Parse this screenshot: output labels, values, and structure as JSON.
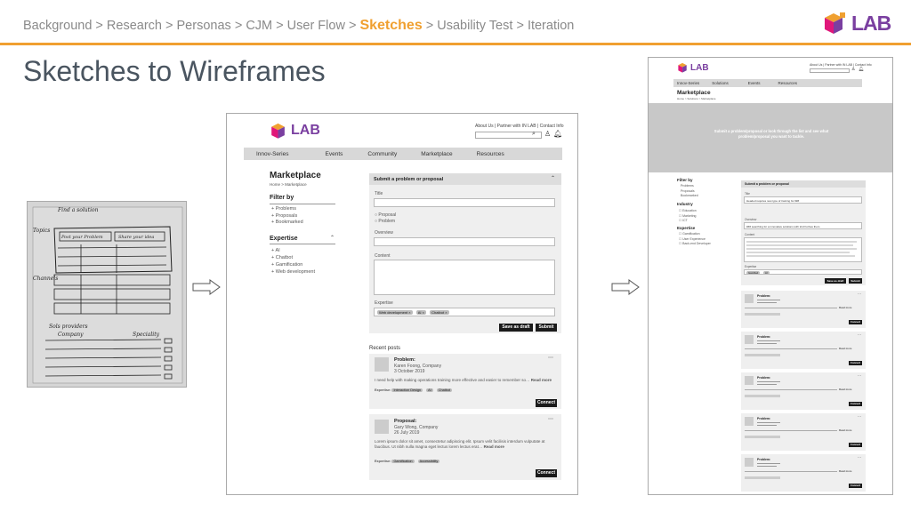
{
  "breadcrumb": [
    "Background",
    "Research",
    "Personas",
    "CJM",
    "User Flow",
    "Sketches",
    "Usability Test",
    "Iteration"
  ],
  "breadcrumb_active": "Sketches",
  "breadcrumb_sep": ">",
  "brand": "LAB",
  "title": "Sketches to Wireframes",
  "colors": {
    "accent": "#f0a030",
    "text_grey": "#8a8a8a",
    "title": "#4a5560",
    "logo_purple": "#7a3fa0",
    "logo_pink": "#e0177a",
    "logo_orange": "#f0a030"
  },
  "sketch": {
    "notes": [
      "Find a solution",
      "Topics",
      "Post your Problem",
      "Share your idea",
      "Channels",
      "Sols providers",
      "Company",
      "Speciality"
    ]
  },
  "wf1": {
    "top_links": "About Us | Partner with IN LAB | Contact Info",
    "nav": [
      "Innov-Series",
      "Events",
      "Community",
      "Marketplace",
      "Resources"
    ],
    "page_title": "Marketplace",
    "breadcrumb": "Home > Marketplace",
    "filter_title": "Filter by",
    "filters": [
      "Problems",
      "Proposals",
      "Bookmarked"
    ],
    "expertise_title": "Expertise",
    "expertise": [
      "AI",
      "Chatbot",
      "Gamification",
      "Web development"
    ],
    "form": {
      "header": "Submit a problem or proposal",
      "title_label": "Title",
      "radio_proposal": "Proposal",
      "radio_problem": "Problem",
      "overview_label": "Overview",
      "content_label": "Content",
      "expertise_label": "Expertise",
      "tags": [
        "Web development",
        "AI",
        "Chatbot"
      ],
      "draft_btn": "Save as draft",
      "submit_btn": "Submit"
    },
    "recent_title": "Recent posts",
    "posts": [
      {
        "type": "Problem:",
        "author": "Karen Foong, Company",
        "date": "3 October 2019",
        "text": "I need help with making operations training more effective and easier to remember so…",
        "more": "Read more",
        "exp_label": "Expertise:",
        "tags": [
          "Interaction Design",
          "AI",
          "Chatbot"
        ],
        "btn": "Connect"
      },
      {
        "type": "Proposal:",
        "author": "Gary Wong, Company",
        "date": "26 July 2019",
        "text": "Lorem ipsum dolor sit amet, consectetur adipiscing elit. Ipsum velit facilisis interdum vulputate at faucibus. Ut nibh nulla magna eget lectus lorem lectus erat…",
        "more": "Read more",
        "exp_label": "Expertise:",
        "tags": [
          "Gamification",
          "Accessibility"
        ],
        "btn": "Connect"
      }
    ]
  },
  "wf2": {
    "top_links": "About Us | Partner with IN LAB | Contact Info",
    "nav": [
      "Innov-Series",
      "Solutions",
      "Events",
      "Resources"
    ],
    "page_title": "Marketplace",
    "breadcrumb": "Home > Solutions > Marketplace",
    "banner": "Submit a problem/proposal or look through the list and see what problem/proposal you want to tackle.",
    "filter_title": "Filter by",
    "filters": [
      "Problems",
      "Proposals",
      "Bookmarked"
    ],
    "industry_title": "Industry",
    "industries": [
      "Education",
      "Marketing",
      "ICT"
    ],
    "expertise_title": "Expertise",
    "expertise": [
      "Gamification",
      "User Experience",
      "Back-end Developer"
    ],
    "form_header": "Submit a problem or proposal",
    "form_title_label": "Title",
    "form_title_value": "Headed requires new type of training for ### ",
    "form_overview_label": "Overview",
    "form_overview_value": "### searching for a innovative solutions with 2nd Forbes them",
    "form_content_label": "Content",
    "form_expertise_label": "Expertise",
    "form_tags": [
      "Gamified",
      "AI"
    ],
    "draft_btn": "Save as draft",
    "submit_btn": "Submit",
    "post_type": "Problem:",
    "post_more": "Read more",
    "post_btn": "Connect",
    "posts_count": 5
  }
}
